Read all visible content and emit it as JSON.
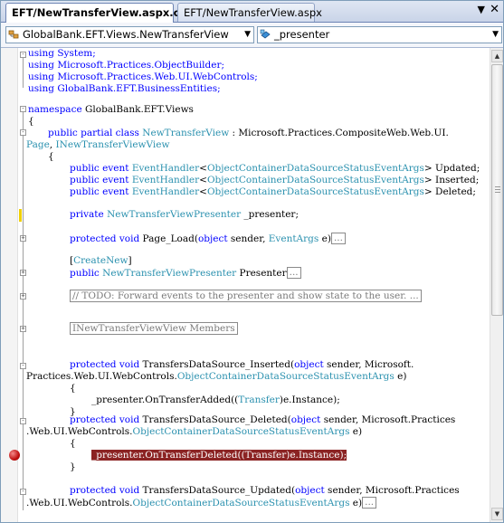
{
  "tabs": [
    {
      "label": "EFT/NewTransferView.aspx.cs*"
    },
    {
      "label": "EFT/NewTransferView.aspx"
    }
  ],
  "tab_controls": {
    "menu_glyph": "▼",
    "close_glyph": "✕"
  },
  "nav": {
    "class_combo": "GlobalBank.EFT.Views.NewTransferView",
    "member_combo": "_presenter"
  },
  "code": {
    "l1": "using System;",
    "l2": "using Microsoft.Practices.ObjectBuilder;",
    "l3": "using Microsoft.Practices.Web.UI.WebControls;",
    "l4": "using GlobalBank.EFT.BusinessEntities;",
    "l5_kw": "namespace",
    "l5_rest": " GlobalBank.EFT.Views",
    "brace_open": "{",
    "brace_close": "}",
    "l6_kw": "public partial class",
    "l6_type": "NewTransferView",
    "l6_rest": " : Microsoft.Practices.CompositeWeb.Web.UI.",
    "l7_type1": "Page",
    "l7_sep": ", ",
    "l7_type2": "INewTransferViewView",
    "ev_kw": "public event",
    "ev_type1": "EventHandler",
    "ev_lt": "<",
    "ev_type2": "ObjectContainerDataSourceStatusEventArgs",
    "ev_gt": ">",
    "ev1_name": " Updated;",
    "ev2_name": " Inserted;",
    "ev3_name": " Deleted;",
    "priv_kw": "private",
    "priv_type": "NewTransferViewPresenter",
    "priv_rest": " _presenter;",
    "pl_kw": "protected void",
    "pl_rest1": " Page_Load(",
    "pl_kw2": "object",
    "pl_rest2": " sender, ",
    "pl_type": "EventArgs",
    "pl_rest3": " e)",
    "ellipsis": "...",
    "attr_open": "[",
    "attr_type": "CreateNew",
    "attr_close": "]",
    "prop_kw": "public",
    "prop_type": "NewTransferViewPresenter",
    "prop_rest": " Presenter",
    "todo": "// TODO: Forward events to the presenter and show state to the user. ...",
    "region": "INewTransferViewView Members",
    "ins_kw": "protected void",
    "ins_rest1": " TransfersDataSource_Inserted(",
    "ins_kw2": "object",
    "ins_rest2": " sender, Microsoft.",
    "ins2_rest": "Practices.Web.UI.WebControls.",
    "ins2_type": "ObjectContainerDataSourceStatusEventArgs",
    "ins2_end": " e)",
    "ins_body_pre": "_presenter.OnTransferAdded((",
    "ins_body_type": "Transfer",
    "ins_body_post": ")e.Instance);",
    "del_kw": "protected void",
    "del_rest1": " TransfersDataSource_Deleted(",
    "del_kw2": "object",
    "del_rest2": " sender, Microsoft.Practices",
    "del2_rest": ".Web.UI.WebControls.",
    "del2_type": "ObjectContainerDataSourceStatusEventArgs",
    "del2_end": " e)",
    "del_body": "_presenter.OnTransferDeleted((Transfer)e.Instance);",
    "upd_kw": "protected void",
    "upd_rest1": " TransfersDataSource_Updated(",
    "upd_kw2": "object",
    "upd_rest2": " sender, Microsoft.Practices",
    "upd2_rest": ".Web.UI.WebControls.",
    "upd2_type": "ObjectContainerDataSourceStatusEventArgs",
    "upd2_end": " e)"
  },
  "colors": {
    "keyword": "#0000ff",
    "type": "#2b91af",
    "breakpoint_highlight": "#8b2323",
    "breakpoint": "#c01010"
  },
  "icons": {
    "class_combo_icon": "class-icon",
    "member_combo_icon": "field-icon",
    "breakpoint": "breakpoint-icon"
  }
}
